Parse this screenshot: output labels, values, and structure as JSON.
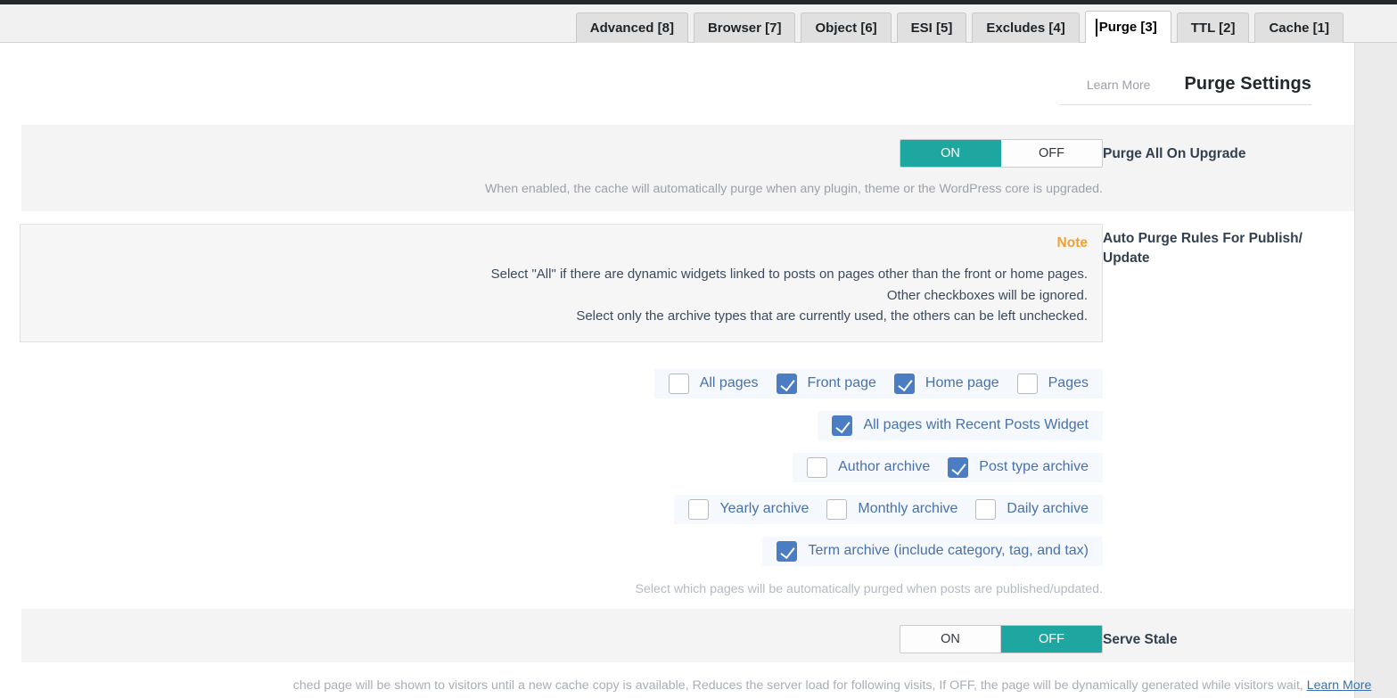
{
  "tabs": [
    {
      "label": "Cache [1]",
      "active": false
    },
    {
      "label": "TTL [2]",
      "active": false
    },
    {
      "label": "Purge [3]",
      "active": true
    },
    {
      "label": "Excludes [4]",
      "active": false
    },
    {
      "label": "ESI [5]",
      "active": false
    },
    {
      "label": "Object [6]",
      "active": false
    },
    {
      "label": "Browser [7]",
      "active": false
    },
    {
      "label": "Advanced [8]",
      "active": false
    }
  ],
  "header": {
    "title": "Purge Settings",
    "learn_more": "Learn More"
  },
  "colors": {
    "accent_teal": "#1ea7a0",
    "checkbox_blue": "#4a7dc4",
    "note_orange": "#f0a033",
    "label_blue": "#4871ab",
    "link_blue": "#3a6fa8"
  },
  "purge_all_on_upgrade": {
    "label": "Purge All On Upgrade",
    "toggle": {
      "on_label": "ON",
      "off_label": "OFF",
      "state": "ON"
    },
    "description": ".When enabled, the cache will automatically purge when any plugin, theme or the WordPress core is upgraded"
  },
  "auto_purge_rules": {
    "label": "Auto Purge Rules For Publish/ Update",
    "note": {
      "title": "Note",
      "lines": [
        ".Select \"All\" if there are dynamic widgets linked to posts on pages other than the front or home pages",
        ".Other checkboxes will be ignored",
        ".Select only the archive types that are currently used, the others can be left unchecked"
      ]
    },
    "checkbox_rows": [
      [
        {
          "label": "Pages",
          "checked": false
        },
        {
          "label": "Home page",
          "checked": true
        },
        {
          "label": "Front page",
          "checked": true
        },
        {
          "label": "All pages",
          "checked": false
        }
      ],
      [
        {
          "label": "All pages with Recent Posts Widget",
          "checked": true
        }
      ],
      [
        {
          "label": "Post type archive",
          "checked": true
        },
        {
          "label": "Author archive",
          "checked": false
        }
      ],
      [
        {
          "label": "Daily archive",
          "checked": false
        },
        {
          "label": "Monthly archive",
          "checked": false
        },
        {
          "label": "Yearly archive",
          "checked": false
        }
      ],
      [
        {
          "label": "Term archive (include category, tag, and tax)",
          "checked": true
        }
      ]
    ],
    "help": ".Select which pages will be automatically purged when posts are published/updated"
  },
  "serve_stale": {
    "label": "Serve Stale",
    "toggle": {
      "on_label": "ON",
      "off_label": "OFF",
      "state": "OFF"
    },
    "description_text": "ched page will be shown to visitors until a new cache copy is available, Reduces the server load for following visits, If OFF, the page will be dynamically generated while visitors wait,",
    "description_link": "Learn More"
  }
}
